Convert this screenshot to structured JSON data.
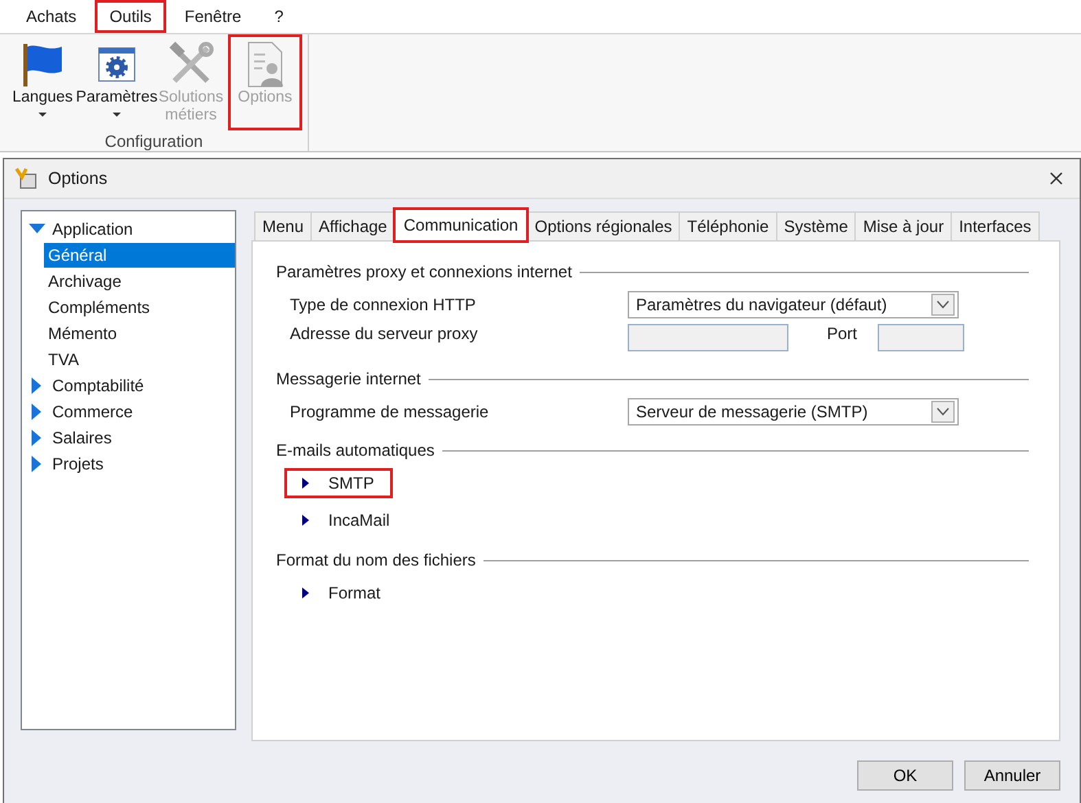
{
  "menu_bar": [
    {
      "label": "Achats",
      "highlighted": false
    },
    {
      "label": "Outils",
      "highlighted": true
    },
    {
      "label": "Fenêtre",
      "highlighted": false
    },
    {
      "label": "?",
      "highlighted": false
    }
  ],
  "ribbon": {
    "group": "Configuration",
    "buttons": [
      {
        "label": "Langues",
        "dropdown": true,
        "disabled": false,
        "highlighted": false
      },
      {
        "label": "Paramètres",
        "dropdown": true,
        "disabled": false,
        "highlighted": false
      },
      {
        "label": "Solutions métiers",
        "dropdown": false,
        "disabled": true,
        "highlighted": false
      },
      {
        "label": "Options",
        "dropdown": false,
        "disabled": true,
        "highlighted": true
      }
    ]
  },
  "dialog": {
    "title": "Options",
    "tree": [
      {
        "label": "Application",
        "expanded": true,
        "selected": false,
        "children": [
          {
            "label": "Général",
            "selected": true
          },
          {
            "label": "Archivage",
            "selected": false
          },
          {
            "label": "Compléments",
            "selected": false
          },
          {
            "label": "Mémento",
            "selected": false
          },
          {
            "label": "TVA",
            "selected": false
          }
        ]
      },
      {
        "label": "Comptabilité",
        "expanded": false,
        "selected": false
      },
      {
        "label": "Commerce",
        "expanded": false,
        "selected": false
      },
      {
        "label": "Salaires",
        "expanded": false,
        "selected": false
      },
      {
        "label": "Projets",
        "expanded": false,
        "selected": false
      }
    ],
    "tabs": [
      {
        "label": "Menu",
        "selected": false,
        "highlighted": false
      },
      {
        "label": "Affichage",
        "selected": false,
        "highlighted": false
      },
      {
        "label": "Communication",
        "selected": true,
        "highlighted": true
      },
      {
        "label": "Options régionales",
        "selected": false,
        "highlighted": false
      },
      {
        "label": "Téléphonie",
        "selected": false,
        "highlighted": false
      },
      {
        "label": "Système",
        "selected": false,
        "highlighted": false
      },
      {
        "label": "Mise à jour",
        "selected": false,
        "highlighted": false
      },
      {
        "label": "Interfaces",
        "selected": false,
        "highlighted": false
      }
    ],
    "sections": [
      {
        "title": "Paramètres proxy et connexions internet",
        "rows": [
          {
            "kind": "select",
            "label": "Type de connexion HTTP",
            "value": "Paramètres du navigateur (défaut)"
          },
          {
            "kind": "address",
            "label": "Adresse du serveur proxy",
            "port_label": "Port",
            "disabled": true
          }
        ]
      },
      {
        "title": "Messagerie internet",
        "rows": [
          {
            "kind": "select",
            "label": "Programme de messagerie",
            "value": "Serveur de messagerie (SMTP)"
          }
        ]
      },
      {
        "title": "E-mails automatiques",
        "rows": [
          {
            "kind": "link",
            "label": "SMTP",
            "highlighted": true
          },
          {
            "kind": "link",
            "label": "IncaMail",
            "highlighted": false
          }
        ]
      },
      {
        "title": "Format du nom des fichiers",
        "rows": [
          {
            "kind": "link",
            "label": "Format",
            "highlighted": false
          }
        ]
      }
    ],
    "buttons": [
      "OK",
      "Annuler"
    ]
  }
}
